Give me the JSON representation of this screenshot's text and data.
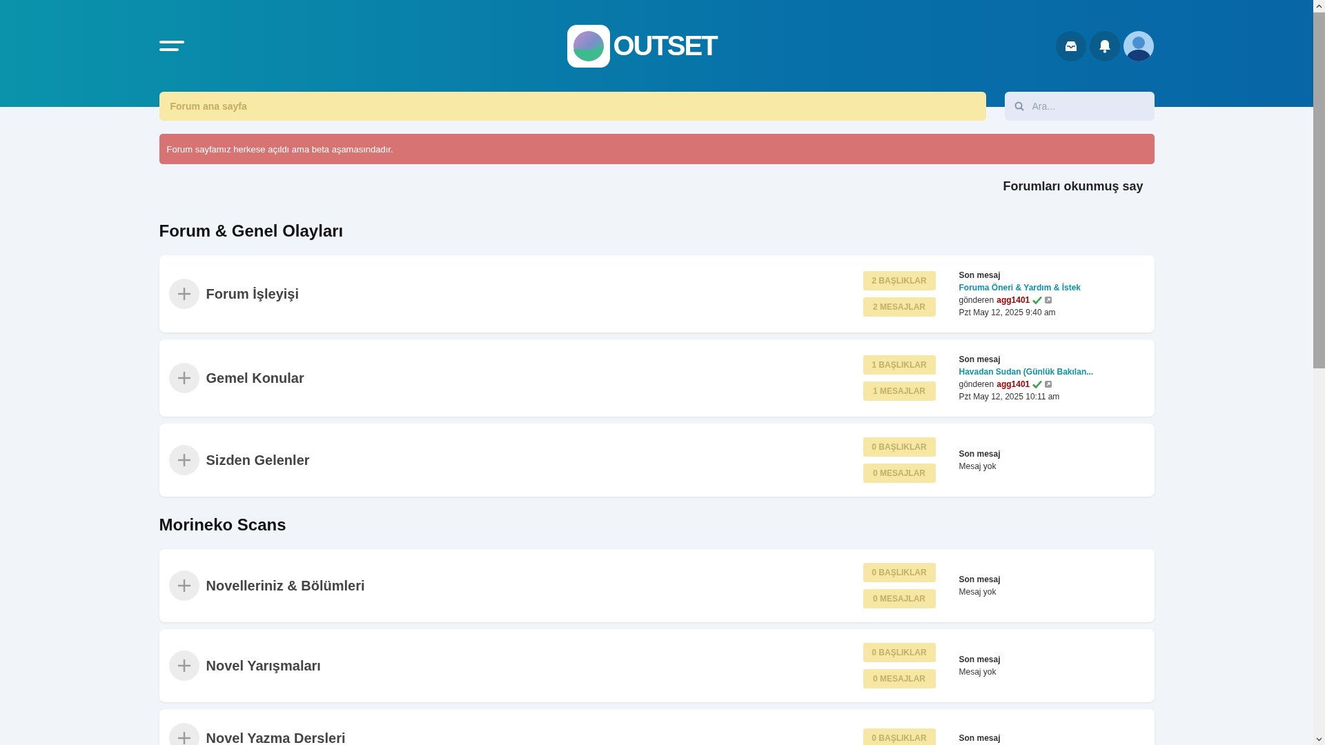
{
  "header": {
    "logo_text": "OUTSET"
  },
  "breadcrumb": "Forum ana sayfa",
  "search": {
    "placeholder": "Ara..."
  },
  "announcement": "Forum sayfamız herkese açıldı ama beta aşamasındadır.",
  "mark_read_link": "Forumları okunmuş say",
  "sections": [
    {
      "title": "Forum & Genel Olayları",
      "forums": [
        {
          "title": "Forum İşleyişi",
          "topics": "2 BAŞLIKLAR",
          "posts": "2 MESAJLAR",
          "last_post": {
            "label": "Son mesaj",
            "title": "Foruma Öneri & Yardım & İstek",
            "by_label": "gönderen",
            "author": "agg1401",
            "date": "Pzt May 12, 2025 9:40 am"
          }
        },
        {
          "title": "Gemel Konular",
          "topics": "1 BAŞLIKLAR",
          "posts": "1 MESAJLAR",
          "last_post": {
            "label": "Son mesaj",
            "title": "Havadan Sudan (Günlük Bakılan...",
            "by_label": "gönderen",
            "author": "agg1401",
            "date": "Pzt May 12, 2025 10:11 am"
          }
        },
        {
          "title": "Sizden Gelenler",
          "topics": "0 BAŞLIKLAR",
          "posts": "0 MESAJLAR",
          "last_post": {
            "label": "Son mesaj",
            "empty_text": "Mesaj yok"
          }
        }
      ]
    },
    {
      "title": "Morineko Scans",
      "forums": [
        {
          "title": "Novelleriniz & Bölümleri",
          "topics": "0 BAŞLIKLAR",
          "posts": "0 MESAJLAR",
          "last_post": {
            "label": "Son mesaj",
            "empty_text": "Mesaj yok"
          }
        },
        {
          "title": "Novel Yarışmaları",
          "topics": "0 BAŞLIKLAR",
          "posts": "0 MESAJLAR",
          "last_post": {
            "label": "Son mesaj",
            "empty_text": "Mesaj yok"
          }
        },
        {
          "title": "Novel Yazma Dersleri",
          "topics": "0 BAŞLIKLAR",
          "last_post": {
            "label": "Son mesaj"
          }
        }
      ]
    }
  ]
}
